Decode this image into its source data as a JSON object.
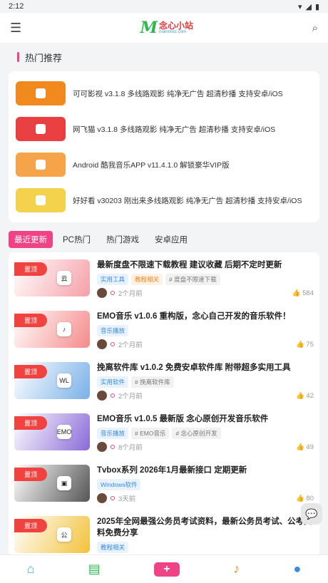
{
  "status": {
    "time": "2:12"
  },
  "header": {
    "logo_mark": "M",
    "logo_cn": "念心小站",
    "logo_en": "nianxinxz.com"
  },
  "hot": {
    "title": "热门推荐",
    "items": [
      {
        "text": "可可影视 v3.1.8 多线路观影 纯净无广告 超清秒播 支持安卓/iOS",
        "color": "#f08a1e"
      },
      {
        "text": "网飞猫 v3.1.8 多线路观影 纯净无广告 超清秒播 支持安卓/iOS",
        "color": "#e84040"
      },
      {
        "text": "Android 酷我音乐APP v11.4.1.0 解锁豪华VIP版",
        "color": "#f5a44a"
      },
      {
        "text": "好好看 v30203 刚出来多线路观影 纯净无广告 超清秒播 支持安卓/iOS",
        "color": "#f2d24a"
      }
    ]
  },
  "tabs": [
    "最近更新",
    "PC热门",
    "热门游戏",
    "安卓应用"
  ],
  "posts": [
    {
      "pin": "置顶",
      "title": "最新度盘不限速下载教程 建议收藏 后期不定时更新",
      "tags": [
        {
          "t": "实用工具",
          "c": "blue"
        },
        {
          "t": "教程相关",
          "c": "orange"
        },
        {
          "t": "# 度盘不限速下载",
          "c": "gray"
        }
      ],
      "time": "2个月前",
      "likes": "584",
      "thumb": "#f5a0a8",
      "icon": "云"
    },
    {
      "pin": "置顶",
      "title": "EMO音乐 v1.0.6 重构版，念心自己开发的音乐软件！",
      "tags": [
        {
          "t": "音乐播放",
          "c": "blue"
        }
      ],
      "time": "2个月前",
      "likes": "75",
      "thumb": "#f58a8a",
      "icon": "♪"
    },
    {
      "pin": "置顶",
      "title": "挽离软件库 v1.0.2 免费安卓软件库 附带超多实用工具",
      "tags": [
        {
          "t": "实用软件",
          "c": "blue"
        },
        {
          "t": "# 挽离软件库",
          "c": "gray"
        }
      ],
      "time": "2个月前",
      "likes": "42",
      "thumb": "#7ab0e8",
      "icon": "WL"
    },
    {
      "pin": "置顶",
      "title": "EMO音乐 v1.0.5 最新版 念心原创开发音乐软件",
      "tags": [
        {
          "t": "音乐播放",
          "c": "blue"
        },
        {
          "t": "# EMO音乐",
          "c": "gray"
        },
        {
          "t": "# 念心原创开发",
          "c": "gray"
        }
      ],
      "time": "8个月前",
      "likes": "49",
      "thumb": "#8a6ad8",
      "icon": "EMO"
    },
    {
      "pin": "置顶",
      "title": "Tvbox系列 2026年1月最新接口 定期更新",
      "tags": [
        {
          "t": "Windows软件",
          "c": "blue"
        }
      ],
      "time": "3天前",
      "likes": "80",
      "thumb": "#555555",
      "icon": "▣"
    },
    {
      "pin": "置顶",
      "title": "2025年全网最强公务员考试资料，最新公务员考试、公考资料免费分享",
      "tags": [
        {
          "t": "教程相关",
          "c": "blue"
        }
      ],
      "time": "",
      "likes": "",
      "thumb": "#f2c23a",
      "icon": "公"
    }
  ],
  "nav": [
    "home-icon",
    "wallet-icon",
    "plus-icon",
    "bell-icon",
    "user-icon"
  ]
}
